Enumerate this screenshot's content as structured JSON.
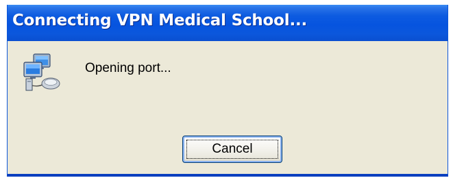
{
  "window": {
    "title": "Connecting VPN Medical School..."
  },
  "dialog": {
    "icon": "network-computers-icon",
    "status": "Opening port..."
  },
  "buttons": {
    "cancel_label": "Cancel"
  },
  "colors": {
    "titlebar": "#0654df",
    "client_background": "#ece9d8",
    "button_border": "#003c74"
  }
}
